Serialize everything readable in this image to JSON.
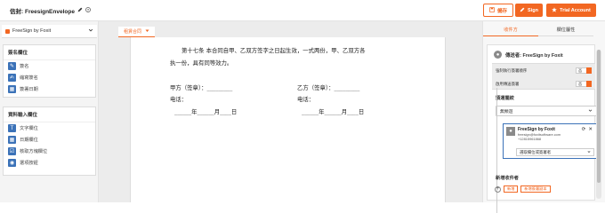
{
  "header": {
    "doc_label": "信封: FreesignEnvelope",
    "save_label": "儲存",
    "sign_label": "Sign",
    "trial_label": "Trial Account"
  },
  "left_sidebar": {
    "account": "FreeSign by Foxit",
    "sections": [
      {
        "title": "簽名欄位",
        "items": [
          {
            "label": "簽名",
            "icon": "signature-icon"
          },
          {
            "label": "縮寫簽名",
            "icon": "initials-icon"
          },
          {
            "label": "簽署日期",
            "icon": "calendar-icon"
          }
        ]
      },
      {
        "title": "資料輸入欄位",
        "items": [
          {
            "label": "文字欄位",
            "icon": "text-field-icon"
          },
          {
            "label": "日期欄位",
            "icon": "date-field-icon"
          },
          {
            "label": "核取方塊欄位",
            "icon": "checkbox-field-icon"
          },
          {
            "label": "選項按鈕",
            "icon": "radio-button-icon"
          }
        ]
      }
    ]
  },
  "document": {
    "tab_label": "租賃合同",
    "lines": [
      "第十七条 本合同自甲、乙双方签字之日起生效，一式两份，甲、乙双方各",
      "执一份，具有同等效力。",
      "甲方（签章）：_________",
      "乙方（签章）：_________",
      "电话：",
      "电话：",
      "______年______月____日",
      "______年______月____日"
    ]
  },
  "right_panel": {
    "tabs": [
      "收件方",
      "欄位屬性"
    ],
    "active_tab": 0,
    "sender_label": "傳送者: FreeSign by Foxit",
    "toggles": [
      {
        "label": "強制執行簽署順序",
        "value": "否"
      },
      {
        "label": "啟用傳送簽署",
        "value": "否"
      }
    ],
    "signing_order_title": "類運擺絞",
    "signing_order_value": "無類遊",
    "signer": {
      "name": "FreeSign by Foxit",
      "email": "freesign@foxitsoftware.com",
      "phone": "+12815961868",
      "role_placeholder": "選取欄位或簽署者"
    },
    "add_recipient_title": "新增收件者",
    "add_buttons": [
      "新增",
      "新增簽署副本"
    ]
  },
  "colors": {
    "accent": "#f26722",
    "link_blue": "#3b72b8"
  }
}
